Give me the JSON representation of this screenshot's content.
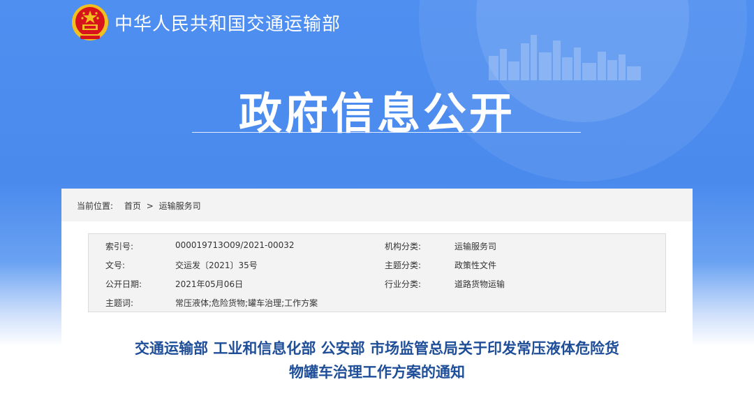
{
  "header": {
    "ministry_name": "中华人民共和国交通运输部",
    "section_title": "政府信息公开"
  },
  "colors": {
    "banner_blue": "#4a8aed",
    "title_blue": "#1f4e99",
    "emblem_red": "#d7141b",
    "emblem_gold": "#f2c01e"
  },
  "breadcrumb": {
    "label": "当前位置:",
    "home": "首页",
    "separator": ">",
    "current": "运输服务司"
  },
  "info": {
    "index_no_label": "索引号:",
    "index_no": "000019713O09/2021-00032",
    "org_label": "机构分类:",
    "org": "运输服务司",
    "doc_no_label": "文号:",
    "doc_no": "交运发〔2021〕35号",
    "topic_label": "主题分类:",
    "topic": "政策性文件",
    "date_label": "公开日期:",
    "date": "2021年05月06日",
    "industry_label": "行业分类:",
    "industry": "道路货物运输",
    "keywords_label": "主题词:",
    "keywords": "常压液体;危险货物;罐车治理;工作方案"
  },
  "document": {
    "title_line1": "交通运输部 工业和信息化部 公安部 市场监管总局关于印发常压液体危险货",
    "title_line2": "物罐车治理工作方案的通知"
  }
}
